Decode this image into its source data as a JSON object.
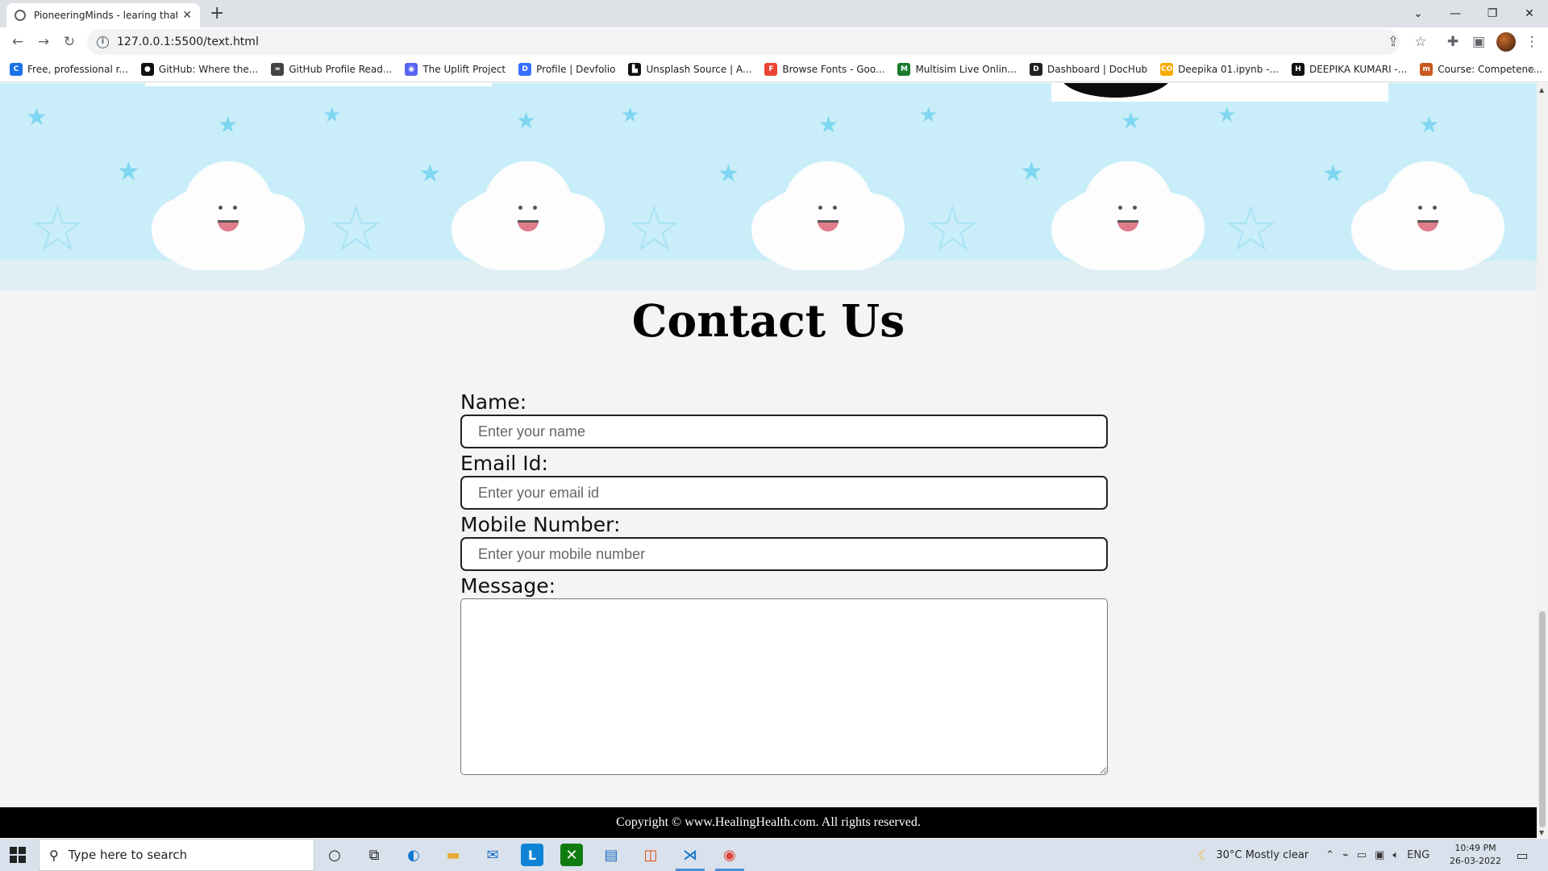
{
  "browser": {
    "tab_title": "PioneeringMinds - learing that in",
    "url": "127.0.0.1:5500/text.html",
    "bookmarks": [
      {
        "label": "Free, professional r...",
        "icon": "c-circle-icon",
        "color": "#1a73e8",
        "glyph": "C"
      },
      {
        "label": "GitHub: Where the...",
        "icon": "github-icon",
        "color": "#111111",
        "glyph": "●"
      },
      {
        "label": "GitHub Profile Read...",
        "icon": "readme-icon",
        "color": "#444444",
        "glyph": "≈"
      },
      {
        "label": "The Uplift Project",
        "icon": "discord-icon",
        "color": "#5865f2",
        "glyph": "◉"
      },
      {
        "label": "Profile | Devfolio",
        "icon": "devfolio-icon",
        "color": "#3770ff",
        "glyph": "D"
      },
      {
        "label": "Unsplash Source | A...",
        "icon": "unsplash-icon",
        "color": "#111111",
        "glyph": "▙"
      },
      {
        "label": "Browse Fonts - Goo...",
        "icon": "google-fonts-icon",
        "color": "#ea4335",
        "glyph": "F"
      },
      {
        "label": "Multisim Live Onlin...",
        "icon": "multisim-icon",
        "color": "#1b7a2e",
        "glyph": "M"
      },
      {
        "label": "Dashboard | DocHub",
        "icon": "dochub-icon",
        "color": "#222222",
        "glyph": "D"
      },
      {
        "label": "Deepika 01.ipynb -...",
        "icon": "colab-icon",
        "color": "#f9ab00",
        "glyph": "CO"
      },
      {
        "label": "DEEPIKA KUMARI -...",
        "icon": "hackerearth-icon",
        "color": "#111111",
        "glyph": "H"
      },
      {
        "label": "Course: Competenc...",
        "icon": "course-icon",
        "color": "#c65a1e",
        "glyph": "m"
      }
    ]
  },
  "page": {
    "title": "Contact Us",
    "form": {
      "name_label": "Name:",
      "name_placeholder": "Enter your name",
      "email_label": "Email Id:",
      "email_placeholder": "Enter your email id",
      "mobile_label": "Mobile Number:",
      "mobile_placeholder": "Enter your mobile number",
      "message_label": "Message:"
    },
    "footer": "Copyright © www.HealingHealth.com. All rights reserved."
  },
  "taskbar": {
    "search_placeholder": "Type here to search",
    "weather": "30°C  Mostly clear",
    "language": "ENG",
    "time": "10:49 PM",
    "date": "26-03-2022"
  },
  "colors": {
    "banner_sky": "#c9eef9",
    "footer_bg": "#000000",
    "page_bg": "#f4f4f4"
  }
}
